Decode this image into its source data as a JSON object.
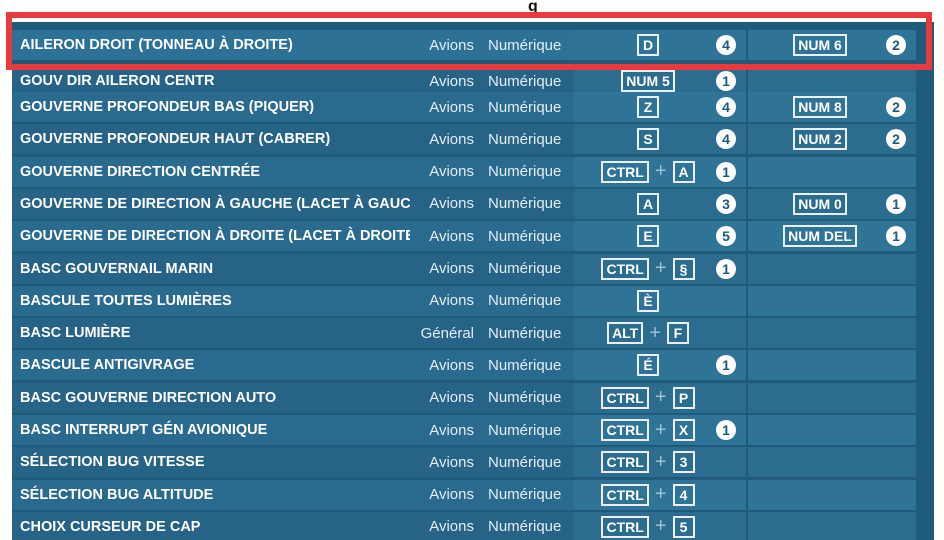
{
  "header": {
    "title_fragment": "g"
  },
  "rows": [
    {
      "name": "AILERON DROIT (TONNEAU À DROITE)",
      "category": "Avions",
      "type": "Numérique",
      "key1": {
        "keys": [
          "D"
        ],
        "count": "4"
      },
      "key2": {
        "keys": [
          "NUM 6"
        ],
        "count": "2"
      }
    },
    {
      "name": "GOUV DIR AILERON CENTR",
      "category": "Avions",
      "type": "Numérique",
      "key1": {
        "keys": [
          "NUM 5"
        ],
        "count": "1"
      },
      "key2": {
        "keys": [],
        "count": ""
      }
    },
    {
      "name": "GOUVERNE PROFONDEUR BAS (PIQUER)",
      "category": "Avions",
      "type": "Numérique",
      "key1": {
        "keys": [
          "Z"
        ],
        "count": "4"
      },
      "key2": {
        "keys": [
          "NUM 8"
        ],
        "count": "2"
      }
    },
    {
      "name": "GOUVERNE PROFONDEUR HAUT (CABRER)",
      "category": "Avions",
      "type": "Numérique",
      "key1": {
        "keys": [
          "S"
        ],
        "count": "4"
      },
      "key2": {
        "keys": [
          "NUM 2"
        ],
        "count": "2"
      }
    },
    {
      "name": "GOUVERNE DIRECTION CENTRÉE",
      "category": "Avions",
      "type": "Numérique",
      "key1": {
        "keys": [
          "CTRL",
          "A"
        ],
        "count": "1"
      },
      "key2": {
        "keys": [],
        "count": ""
      }
    },
    {
      "name": "GOUVERNE DE DIRECTION À GAUCHE (LACET À GAUCI",
      "category": "Avions",
      "type": "Numérique",
      "key1": {
        "keys": [
          "A"
        ],
        "count": "3"
      },
      "key2": {
        "keys": [
          "NUM 0"
        ],
        "count": "1"
      }
    },
    {
      "name": "GOUVERNE DE DIRECTION À DROITE (LACET À DROITE",
      "category": "Avions",
      "type": "Numérique",
      "key1": {
        "keys": [
          "E"
        ],
        "count": "5"
      },
      "key2": {
        "keys": [
          "NUM DEL"
        ],
        "count": "1"
      }
    },
    {
      "name": "BASC GOUVERNAIL MARIN",
      "category": "Avions",
      "type": "Numérique",
      "key1": {
        "keys": [
          "CTRL",
          "§"
        ],
        "count": "1"
      },
      "key2": {
        "keys": [],
        "count": ""
      }
    },
    {
      "name": "BASCULE TOUTES LUMIÈRES",
      "category": "Avions",
      "type": "Numérique",
      "key1": {
        "keys": [
          "È"
        ],
        "count": ""
      },
      "key2": {
        "keys": [],
        "count": ""
      }
    },
    {
      "name": "BASC LUMIÈRE",
      "category": "Général",
      "type": "Numérique",
      "key1": {
        "keys": [
          "ALT",
          "F"
        ],
        "count": ""
      },
      "key2": {
        "keys": [],
        "count": ""
      }
    },
    {
      "name": "BASCULE ANTIGIVRAGE",
      "category": "Avions",
      "type": "Numérique",
      "key1": {
        "keys": [
          "É"
        ],
        "count": "1"
      },
      "key2": {
        "keys": [],
        "count": ""
      }
    },
    {
      "name": "BASC GOUVERNE DIRECTION AUTO",
      "category": "Avions",
      "type": "Numérique",
      "key1": {
        "keys": [
          "CTRL",
          "P"
        ],
        "count": ""
      },
      "key2": {
        "keys": [],
        "count": ""
      }
    },
    {
      "name": "BASC INTERRUPT GÉN AVIONIQUE",
      "category": "Avions",
      "type": "Numérique",
      "key1": {
        "keys": [
          "CTRL",
          "X"
        ],
        "count": "1"
      },
      "key2": {
        "keys": [],
        "count": ""
      }
    },
    {
      "name": "SÉLECTION BUG VITESSE",
      "category": "Avions",
      "type": "Numérique",
      "key1": {
        "keys": [
          "CTRL",
          "3"
        ],
        "count": ""
      },
      "key2": {
        "keys": [],
        "count": ""
      }
    },
    {
      "name": "SÉLECTION BUG ALTITUDE",
      "category": "Avions",
      "type": "Numérique",
      "key1": {
        "keys": [
          "CTRL",
          "4"
        ],
        "count": ""
      },
      "key2": {
        "keys": [],
        "count": ""
      }
    },
    {
      "name": "CHOIX CURSEUR DE CAP",
      "category": "Avions",
      "type": "Numérique",
      "key1": {
        "keys": [
          "CTRL",
          "5"
        ],
        "count": ""
      },
      "key2": {
        "keys": [],
        "count": ""
      }
    }
  ],
  "colors": {
    "highlight": "#e8393d",
    "panel": "#1f5a7a"
  }
}
